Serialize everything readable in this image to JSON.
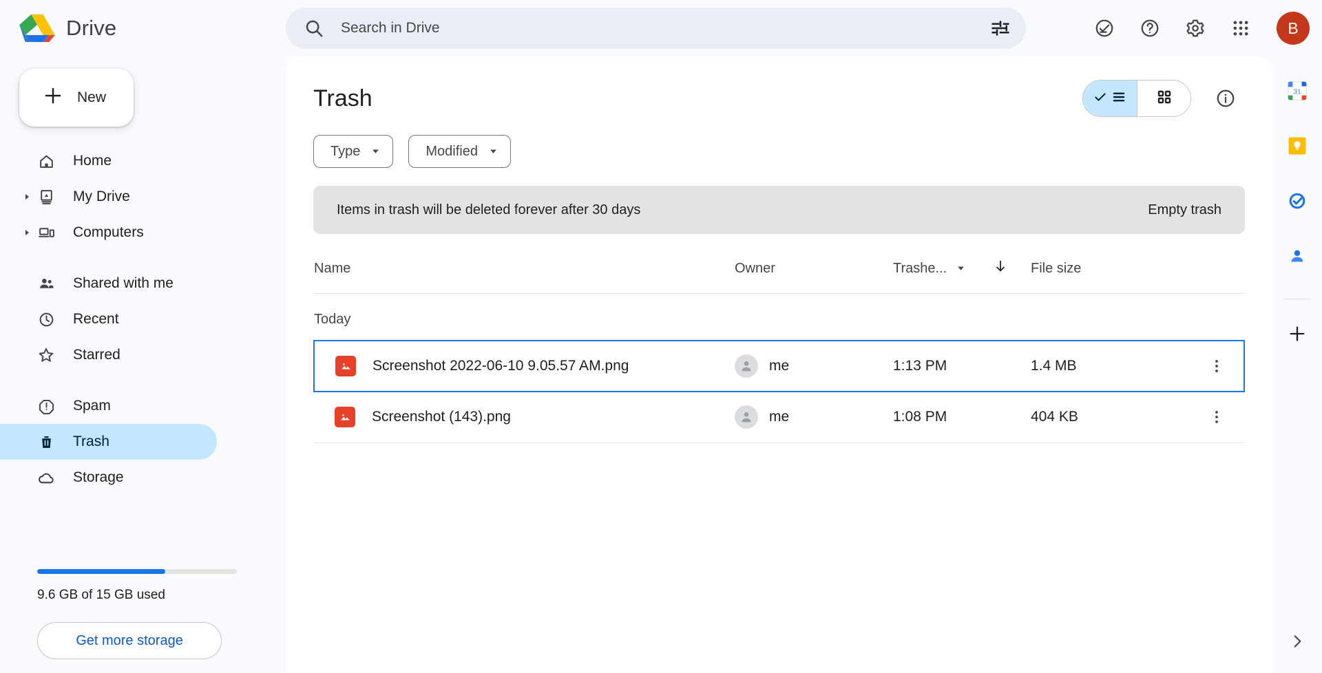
{
  "app": {
    "brand": "Drive",
    "avatar_initial": "B",
    "avatar_color": "#c5371a"
  },
  "search": {
    "placeholder": "Search in Drive",
    "value": ""
  },
  "header_icons": [
    {
      "name": "activity-check-icon",
      "label": "Activity"
    },
    {
      "name": "help-icon",
      "label": "Support"
    },
    {
      "name": "settings-gear-icon",
      "label": "Settings"
    },
    {
      "name": "apps-grid-icon",
      "label": "Google apps"
    }
  ],
  "sidebar": {
    "new_label": "New",
    "items": [
      {
        "label": "Home",
        "icon": "home-icon",
        "expandable": false,
        "active": false
      },
      {
        "label": "My Drive",
        "icon": "my-drive-icon",
        "expandable": true,
        "active": false
      },
      {
        "label": "Computers",
        "icon": "computers-icon",
        "expandable": true,
        "active": false
      },
      {
        "label": "Shared with me",
        "icon": "people-icon",
        "expandable": false,
        "active": false
      },
      {
        "label": "Recent",
        "icon": "clock-icon",
        "expandable": false,
        "active": false
      },
      {
        "label": "Starred",
        "icon": "star-icon",
        "expandable": false,
        "active": false
      },
      {
        "label": "Spam",
        "icon": "spam-icon",
        "expandable": false,
        "active": false
      },
      {
        "label": "Trash",
        "icon": "trash-icon",
        "expandable": false,
        "active": true
      },
      {
        "label": "Storage",
        "icon": "cloud-icon",
        "expandable": false,
        "active": false
      }
    ],
    "storage": {
      "used_text": "9.6 GB of 15 GB used",
      "percent": 64,
      "bar_color": "#1a73e8",
      "get_more_label": "Get more storage"
    }
  },
  "main": {
    "page_title": "Trash",
    "view_toggle": {
      "list_label": "",
      "grid_label": "",
      "active": "list"
    },
    "info_label": "",
    "chips": [
      {
        "label": "Type"
      },
      {
        "label": "Modified"
      }
    ],
    "notice": {
      "message": "Items in trash will be deleted forever after 30 days",
      "action": "Empty trash"
    },
    "columns": {
      "name": "Name",
      "owner": "Owner",
      "trashed": "Trashe...",
      "size": "File size"
    },
    "groups": [
      {
        "label": "Today",
        "rows": [
          {
            "name": "Screenshot 2022-06-10 9.05.57 AM.png",
            "owner": "me",
            "trashed": "1:13 PM",
            "size": "1.4 MB",
            "icon": "image-file-icon",
            "selected": true
          },
          {
            "name": "Screenshot (143).png",
            "owner": "me",
            "trashed": "1:08 PM",
            "size": "404 KB",
            "icon": "image-file-icon",
            "selected": false
          }
        ]
      }
    ]
  },
  "rail": {
    "items": [
      {
        "name": "google-calendar-icon",
        "label": "Calendar",
        "badge": "31"
      },
      {
        "name": "google-keep-icon",
        "label": "Keep"
      },
      {
        "name": "google-tasks-icon",
        "label": "Tasks"
      },
      {
        "name": "google-contacts-icon",
        "label": "Contacts"
      }
    ],
    "add_label": "",
    "expand_label": ""
  }
}
